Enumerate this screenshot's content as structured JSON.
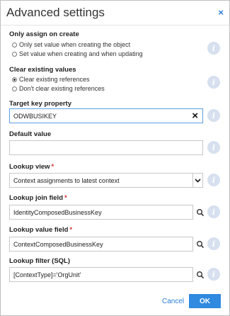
{
  "dialog": {
    "title": "Advanced settings",
    "close_label": "×"
  },
  "only_assign": {
    "label": "Only assign on create",
    "options": [
      {
        "label": "Only set value when creating the object",
        "checked": false
      },
      {
        "label": "Set value when creating and when updating",
        "checked": false
      }
    ]
  },
  "clear_existing": {
    "label": "Clear existing values",
    "options": [
      {
        "label": "Clear existing references",
        "checked": true
      },
      {
        "label": "Don't clear existing references",
        "checked": false
      }
    ]
  },
  "target_key": {
    "label": "Target key property",
    "value": "ODWBUSIKEY",
    "clear_icon": "×"
  },
  "default_value": {
    "label": "Default value",
    "value": ""
  },
  "lookup_view": {
    "label": "Lookup view",
    "required": "*",
    "value": "Context assignments to latest context"
  },
  "lookup_join": {
    "label": "Lookup join field",
    "required": "*",
    "value": "IdentityComposedBusinessKey"
  },
  "lookup_value": {
    "label": "Lookup value field",
    "required": "*",
    "value": "ContextComposedBusinessKey"
  },
  "lookup_filter": {
    "label": "Lookup filter (SQL)",
    "value": "[ContextType]='OrgUnit'"
  },
  "info_glyph": "i",
  "footer": {
    "cancel_label": "Cancel",
    "ok_label": "OK"
  },
  "colors": {
    "accent": "#2f8ae0",
    "link": "#2b7ed8",
    "required": "#d32f2f",
    "info_bg": "#d6e0ee"
  }
}
